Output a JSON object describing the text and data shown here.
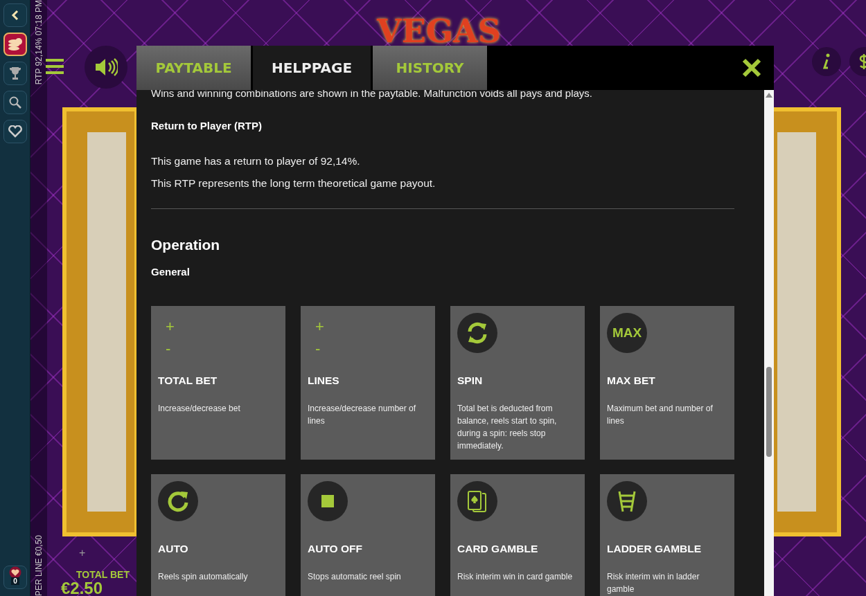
{
  "game": {
    "logo": "VEGAS",
    "rtp_clock": "RTP 92,14% 07:18 PM",
    "per_line": "PER LINE €0,50",
    "total_bet_label": "TOTAL BET",
    "total_bet_value": "€2.50",
    "plus": "+"
  },
  "sidebar": {
    "badge_count": "0"
  },
  "tabs": [
    {
      "label": "PAYTABLE",
      "selected": false
    },
    {
      "label": "HELPPAGE",
      "selected": true
    },
    {
      "label": "HISTORY",
      "selected": false
    }
  ],
  "help": {
    "intro": "Wins and winning combinations are shown in the paytable. Malfunction voids all pays and plays.",
    "rtp_heading": "Return to Player (RTP)",
    "rtp_lines": [
      "This game has a return to player of 92,14%.",
      "This RTP represents the long term theoretical game payout."
    ],
    "section_title": "Operation",
    "subsection": "General",
    "cards": [
      {
        "kind": "plusminus",
        "plus": "+",
        "minus": "-",
        "title": "TOTAL BET",
        "desc": "Increase/decrease bet"
      },
      {
        "kind": "plusminus",
        "plus": "+",
        "minus": "-",
        "title": "LINES",
        "desc": "Increase/decrease number of lines"
      },
      {
        "kind": "spin",
        "title": "SPIN",
        "desc": "Total bet is deducted from balance, reels start to spin, during a spin: reels stop immediately."
      },
      {
        "kind": "max",
        "badge": "MAX",
        "title": "MAX BET",
        "desc": "Maximum bet and number of lines"
      },
      {
        "kind": "auto",
        "title": "AUTO",
        "desc": "Reels spin automatically"
      },
      {
        "kind": "stop",
        "title": "AUTO OFF",
        "desc": "Stops automatic reel spin"
      },
      {
        "kind": "card",
        "title": "CARD GAMBLE",
        "desc": "Risk interim win in card gamble"
      },
      {
        "kind": "ladder",
        "title": "LADDER GAMBLE",
        "desc": "Risk interim win in ladder gamble"
      }
    ]
  }
}
